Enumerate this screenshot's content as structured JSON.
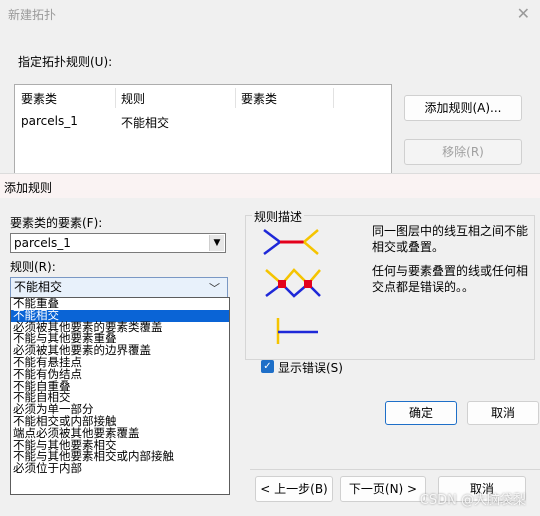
{
  "back_dialog": {
    "title": "新建拓扑",
    "close_icon": "close-icon",
    "rules_label": "指定拓扑规则(U):",
    "table": {
      "columns": [
        "要素类",
        "规则",
        "要素类"
      ],
      "rows": [
        [
          "parcels_1",
          "不能相交",
          ""
        ]
      ]
    },
    "add_rule_label": "添加规则(A)...",
    "remove_label": "移除(R)",
    "back_label": "< 上一步(B)",
    "next_label": "下一页(N) >",
    "cancel_label": "取消"
  },
  "add_rule_dialog": {
    "title": "添加规则",
    "feature_class_label": "要素类的要素(F):",
    "feature_class_value": "parcels_1",
    "rule_label": "规则(R):",
    "rule_value": "不能相交",
    "rule_options": [
      "不能重叠",
      "不能相交",
      "必须被其他要素的要素类覆盖",
      "不能与其他要素重叠",
      "必须被其他要素的边界覆盖",
      "不能有悬挂点",
      "不能有伪结点",
      "不能自重叠",
      "不能自相交",
      "必须为单一部分",
      "不能相交或内部接触",
      "端点必须被其他要素覆盖",
      "不能与其他要素相交",
      "不能与其他要素相交或内部接触",
      "必须位于内部"
    ],
    "selected_index": 1,
    "description_group_title": "规则描述",
    "description_line1": "同一图层中的线互相之间不能相交或叠置。",
    "description_line2": "任何与要素叠置的线或任何相交点都是错误的。。",
    "show_errors_label": "显示错误(S)",
    "show_errors_checked": true,
    "ok_label": "确定",
    "cancel_label": "取消"
  },
  "watermark": "CSDN @大脑袋梨",
  "colors": {
    "accent": "#0a64d6",
    "rule_red": "#e3001b",
    "rule_yellow": "#f5c400",
    "rule_blue": "#1e28d8"
  }
}
